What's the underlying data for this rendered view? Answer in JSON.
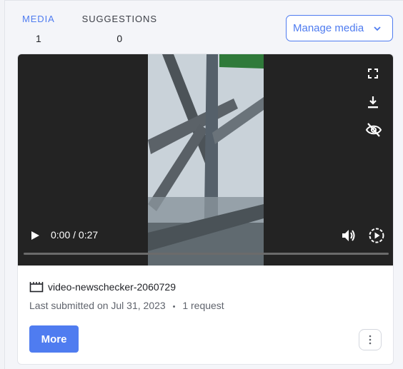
{
  "tabs": [
    {
      "label": "MEDIA",
      "count": "1",
      "active": true
    },
    {
      "label": "SUGGESTIONS",
      "count": "0",
      "active": false
    }
  ],
  "manage_button": {
    "label": "Manage media",
    "icon": "chevron-down-icon"
  },
  "video": {
    "time": "0:00 / 0:27",
    "progress": 0,
    "controls": [
      "fullscreen-icon",
      "download-icon",
      "hide-eye-icon",
      "play-icon",
      "volume-icon",
      "playback-speed-icon"
    ]
  },
  "media_item": {
    "filename": "video-newschecker-2060729",
    "submitted": "Last submitted on Jul 31, 2023",
    "separator": "•",
    "requests": "1 request"
  },
  "more_button": {
    "label": "More"
  },
  "colors": {
    "accent": "#4f7cf0",
    "player_bg": "#232323"
  }
}
